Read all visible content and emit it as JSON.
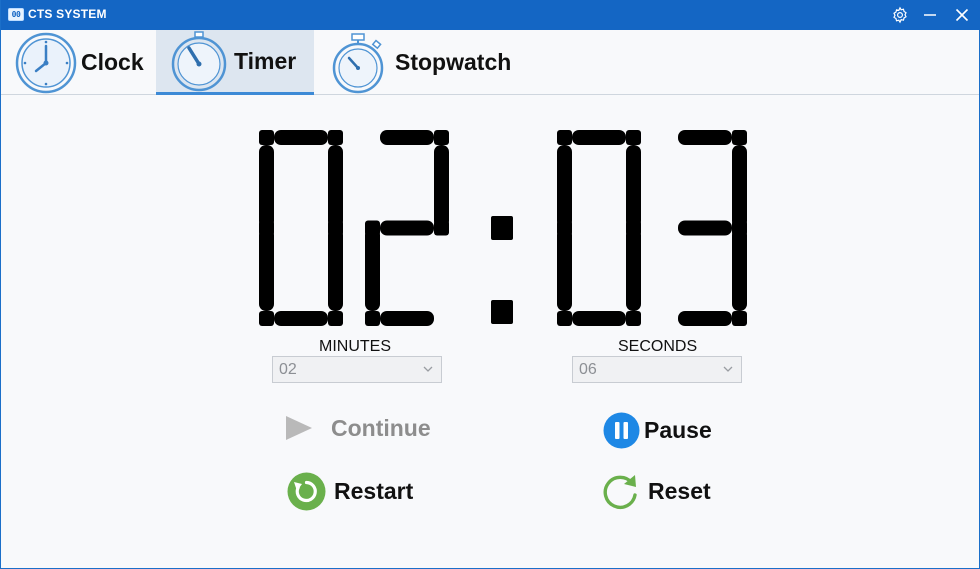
{
  "titlebar": {
    "app_icon_text": "00",
    "title": "CTS SYSTEM",
    "icons": [
      "settings-icon",
      "minimize-icon",
      "close-icon"
    ]
  },
  "tabs": [
    {
      "label": "Clock",
      "icon": "clock-icon",
      "selected": false
    },
    {
      "label": "Timer",
      "icon": "timer-icon",
      "selected": true
    },
    {
      "label": "Stopwatch",
      "icon": "stopwatch-icon",
      "selected": false
    }
  ],
  "display": {
    "minutes": "02",
    "separator": ":",
    "seconds": "03"
  },
  "fields": {
    "minutes_label": "MINUTES",
    "minutes_value": "02",
    "seconds_label": "SECONDS",
    "seconds_value": "06"
  },
  "actions": {
    "continue": "Continue",
    "pause": "Pause",
    "restart": "Restart",
    "reset": "Reset"
  },
  "colors": {
    "titlebar": "#1466c4",
    "accent": "#3d8ad6",
    "pause_blue": "#1e88e5",
    "restart_green": "#6ab04c",
    "disabled_gray": "#8d8d8d"
  }
}
